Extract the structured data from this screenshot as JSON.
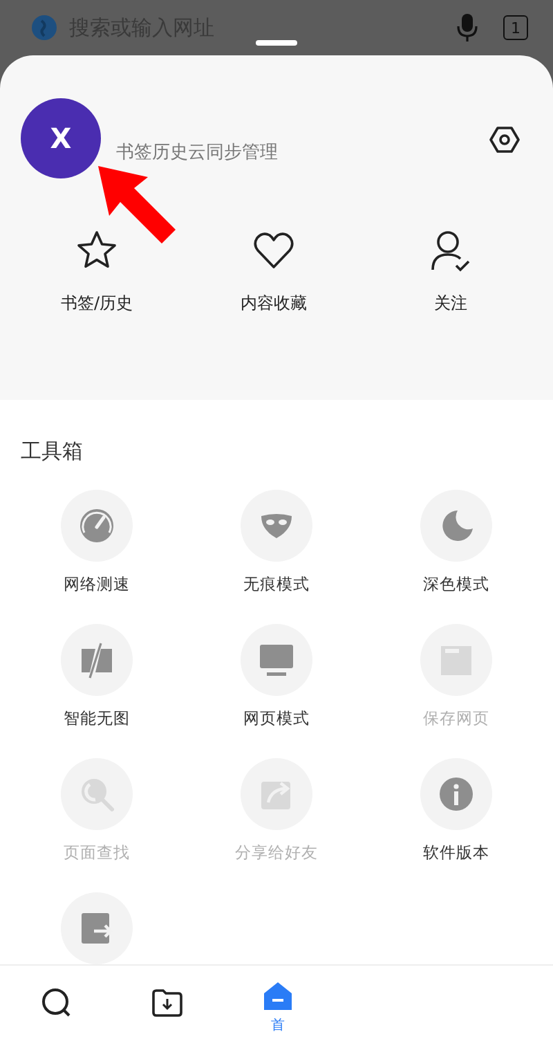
{
  "address_bar": {
    "placeholder": "搜索或输入网址",
    "tab_count": "1"
  },
  "account": {
    "avatar_letter": "X",
    "subtitle": "书签历史云同步管理"
  },
  "shortcuts": [
    {
      "kind": "star",
      "label": "书签/历史"
    },
    {
      "kind": "heart",
      "label": "内容收藏"
    },
    {
      "kind": "follow",
      "label": "关注"
    }
  ],
  "toolbox": {
    "title": "工具箱",
    "items": [
      {
        "kind": "speed",
        "label": "网络测速",
        "disabled": false
      },
      {
        "kind": "mask",
        "label": "无痕模式",
        "disabled": false
      },
      {
        "kind": "moon",
        "label": "深色模式",
        "disabled": false
      },
      {
        "kind": "noimage",
        "label": "智能无图",
        "disabled": false
      },
      {
        "kind": "monitor",
        "label": "网页模式",
        "disabled": false
      },
      {
        "kind": "save",
        "label": "保存网页",
        "disabled": true
      },
      {
        "kind": "find",
        "label": "页面查找",
        "disabled": true
      },
      {
        "kind": "share",
        "label": "分享给好友",
        "disabled": true
      },
      {
        "kind": "info",
        "label": "软件版本",
        "disabled": false
      },
      {
        "kind": "exit",
        "disabled": false
      }
    ]
  },
  "nav": [
    {
      "kind": "search",
      "selected": false
    },
    {
      "kind": "download",
      "selected": false
    },
    {
      "kind": "home",
      "label": "首",
      "selected": true
    }
  ]
}
